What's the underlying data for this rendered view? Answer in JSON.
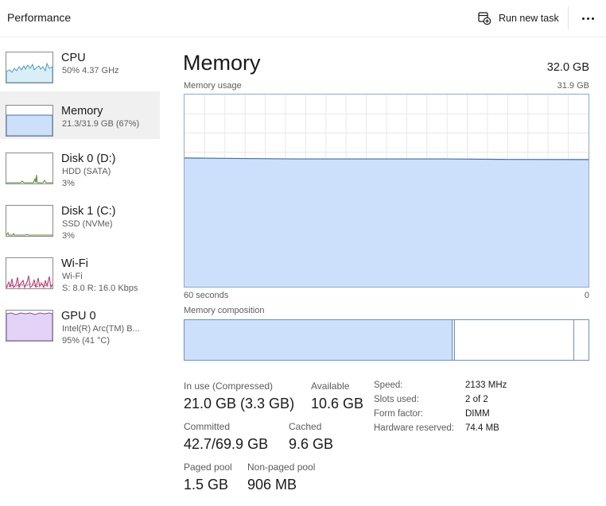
{
  "header": {
    "title": "Performance",
    "run_new_task_label": "Run new task",
    "run_new_task_icon": "run-task-icon",
    "more_icon": "more-options-icon"
  },
  "sidebar": {
    "items": [
      {
        "name": "CPU",
        "lines": [
          "50%  4.37 GHz"
        ],
        "graph_color": "#4a9fc2",
        "graph_fill": "#d9eef6",
        "selected": false
      },
      {
        "name": "Memory",
        "lines": [
          "21.3/31.9 GB (67%)"
        ],
        "graph_color": "#3f6ea8",
        "graph_fill": "#cde0fb",
        "selected": true
      },
      {
        "name": "Disk 0 (D:)",
        "lines": [
          "HDD (SATA)",
          "3%"
        ],
        "graph_color": "#5e8a3a",
        "graph_fill": "#e5f0d6",
        "selected": false
      },
      {
        "name": "Disk 1 (C:)",
        "lines": [
          "SSD (NVMe)",
          "3%"
        ],
        "graph_color": "#5e8a3a",
        "graph_fill": "#e5f0d6",
        "selected": false
      },
      {
        "name": "Wi-Fi",
        "lines": [
          "Wi-Fi",
          "S: 8.0  R: 16.0 Kbps"
        ],
        "graph_color": "#b03a6e",
        "graph_fill": "#f6dde8",
        "selected": false
      },
      {
        "name": "GPU 0",
        "lines": [
          "Intel(R) Arc(TM) B...",
          "95%  (41 °C)"
        ],
        "graph_color": "#7b4fb5",
        "graph_fill": "#e3d3f6",
        "selected": false
      }
    ]
  },
  "main": {
    "title": "Memory",
    "total": "32.0 GB",
    "usage_label": "Memory usage",
    "usage_max": "31.9 GB",
    "time_left": "60 seconds",
    "time_right": "0",
    "composition_label": "Memory composition",
    "usage_level": 0.67,
    "accent_color": "#3f6ea8",
    "fill_color": "#cde0fb"
  },
  "stats": {
    "in_use_label": "In use (Compressed)",
    "in_use_value": "21.0 GB (3.3 GB)",
    "available_label": "Available",
    "available_value": "10.6 GB",
    "committed_label": "Committed",
    "committed_value": "42.7/69.9 GB",
    "cached_label": "Cached",
    "cached_value": "9.6 GB",
    "paged_label": "Paged pool",
    "paged_value": "1.5 GB",
    "nonpaged_label": "Non-paged pool",
    "nonpaged_value": "906 MB"
  },
  "properties": [
    {
      "label": "Speed:",
      "value": "2133 MHz"
    },
    {
      "label": "Slots used:",
      "value": "2 of 2"
    },
    {
      "label": "Form factor:",
      "value": "DIMM"
    },
    {
      "label": "Hardware reserved:",
      "value": "74.4 MB"
    }
  ]
}
